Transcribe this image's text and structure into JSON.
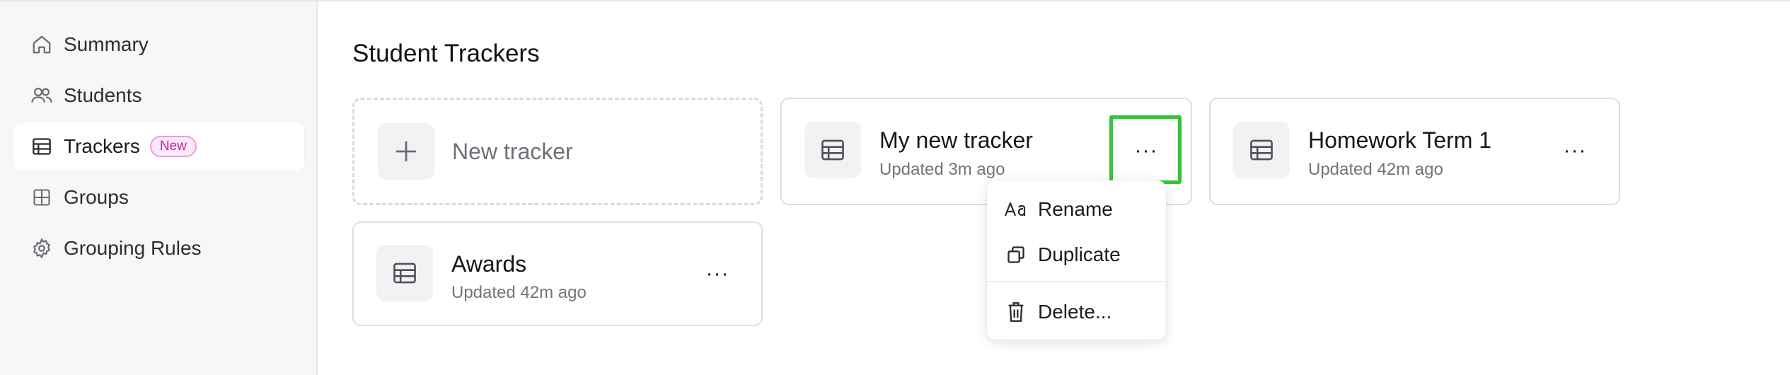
{
  "sidebar": {
    "items": [
      {
        "label": "Summary",
        "icon": "home-icon"
      },
      {
        "label": "Students",
        "icon": "users-icon"
      },
      {
        "label": "Trackers",
        "icon": "table-icon",
        "badge": "New",
        "active": true
      },
      {
        "label": "Groups",
        "icon": "grid-icon"
      },
      {
        "label": "Grouping Rules",
        "icon": "gear-icon"
      }
    ]
  },
  "main": {
    "title": "Student Trackers",
    "new_tracker_label": "New tracker",
    "trackers": [
      {
        "title": "My new tracker",
        "updated": "Updated 3m ago",
        "more": "···"
      },
      {
        "title": "Homework Term 1",
        "updated": "Updated 42m ago",
        "more": "···"
      },
      {
        "title": "Awards",
        "updated": "Updated 42m ago",
        "more": "···"
      }
    ]
  },
  "menu": {
    "items": [
      {
        "label": "Rename",
        "icon": "text-icon"
      },
      {
        "label": "Duplicate",
        "icon": "copy-icon"
      },
      {
        "label": "Delete...",
        "icon": "trash-icon"
      }
    ]
  },
  "colors": {
    "badge_bg": "#fde8fb",
    "badge_border": "#ef9ae4",
    "badge_text": "#b0289f",
    "highlight": "#34c534"
  }
}
